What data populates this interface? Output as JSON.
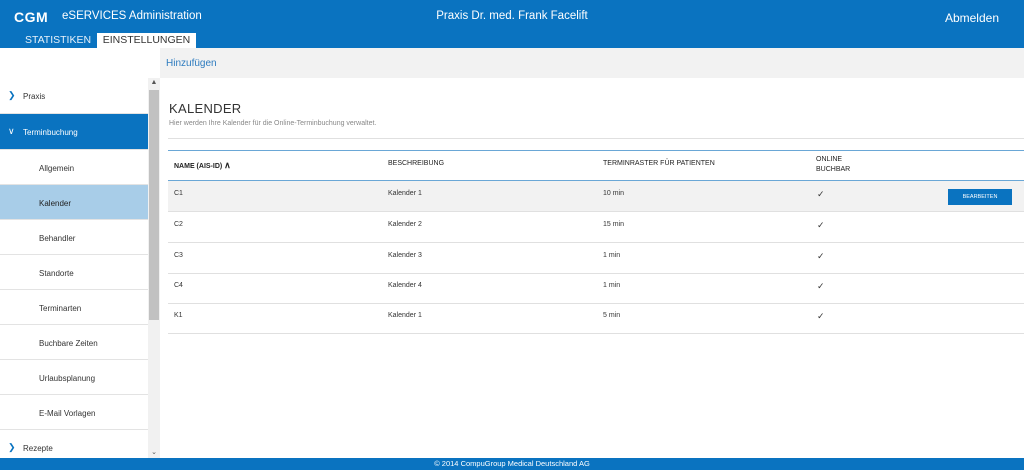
{
  "header": {
    "logo": "CGM",
    "app_title": "eSERVICES Administration",
    "praxis": "Praxis Dr. med. Frank Facelift",
    "logout": "Abmelden"
  },
  "tabs": [
    {
      "label": "STATISTIKEN"
    },
    {
      "label": "EINSTELLUNGEN"
    }
  ],
  "actionbar": {
    "add": "Hinzufügen"
  },
  "sidebar": {
    "items": [
      {
        "label": "Praxis"
      },
      {
        "label": "Terminbuchung"
      },
      {
        "label": "Allgemein"
      },
      {
        "label": "Kalender"
      },
      {
        "label": "Behandler"
      },
      {
        "label": "Standorte"
      },
      {
        "label": "Terminarten"
      },
      {
        "label": "Buchbare Zeiten"
      },
      {
        "label": "Urlaubsplanung"
      },
      {
        "label": "E-Mail Vorlagen"
      },
      {
        "label": "Rezepte"
      }
    ]
  },
  "main": {
    "title": "KALENDER",
    "subtitle": "Hier werden Ihre Kalender für die Online-Terminbuchung verwaltet.",
    "columns": [
      "NAME (AIS-ID)",
      "BESCHREIBUNG",
      "TERMINRASTER FÜR PATIENTEN",
      "ONLINE",
      "BUCHBAR"
    ],
    "rows": [
      {
        "name": "C1",
        "desc": "Kalender 1",
        "raster": "10 min",
        "online": "✓"
      },
      {
        "name": "C2",
        "desc": "Kalender 2",
        "raster": "15 min",
        "online": "✓"
      },
      {
        "name": "C3",
        "desc": "Kalender 3",
        "raster": "1 min",
        "online": "✓"
      },
      {
        "name": "C4",
        "desc": "Kalender 4",
        "raster": "1 min",
        "online": "✓"
      },
      {
        "name": "K1",
        "desc": "Kalender 1",
        "raster": "5 min",
        "online": "✓"
      }
    ],
    "edit_label": "BEARBEITEN"
  },
  "footer": {
    "text": "© 2014 CompuGroup Medical Deutschland AG"
  },
  "colors": {
    "primary": "#0a73c0",
    "selected": "#a8cde8"
  }
}
